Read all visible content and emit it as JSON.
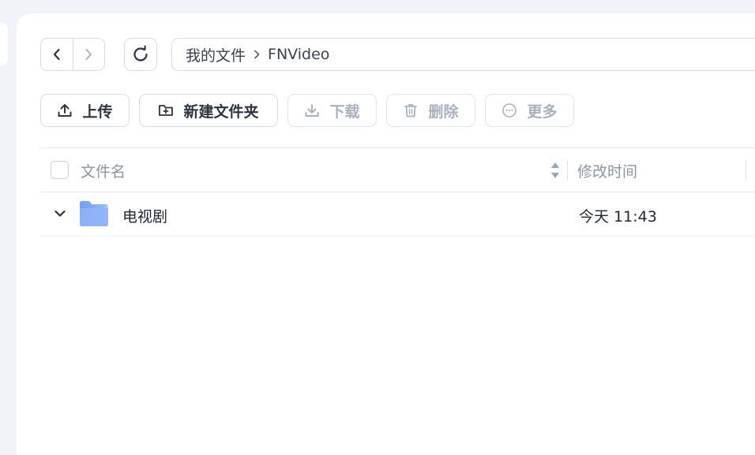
{
  "navigation": {
    "back_icon": "chevron-left-icon",
    "forward_icon": "chevron-right-icon",
    "refresh_icon": "refresh-icon"
  },
  "breadcrumb": {
    "items": [
      "我的文件",
      "FNVideo"
    ],
    "separator_icon": "chevron-right-icon"
  },
  "toolbar": {
    "upload_label": "上传",
    "new_folder_label": "新建文件夹",
    "download_label": "下载",
    "delete_label": "删除",
    "more_label": "更多"
  },
  "table": {
    "columns": [
      "文件名",
      "修改时间"
    ],
    "rows": [
      {
        "name": "电视剧",
        "modified": "今天 11:43",
        "type": "folder",
        "icon": "folder-icon"
      }
    ]
  },
  "colors": {
    "background": "#f0f3f8",
    "panel": "#ffffff",
    "border": "#d5dbe4",
    "text": "#1f2633",
    "muted_text": "#8a94a3",
    "disabled_text": "#a8b1be",
    "folder_blue": "#7aa7f5"
  }
}
